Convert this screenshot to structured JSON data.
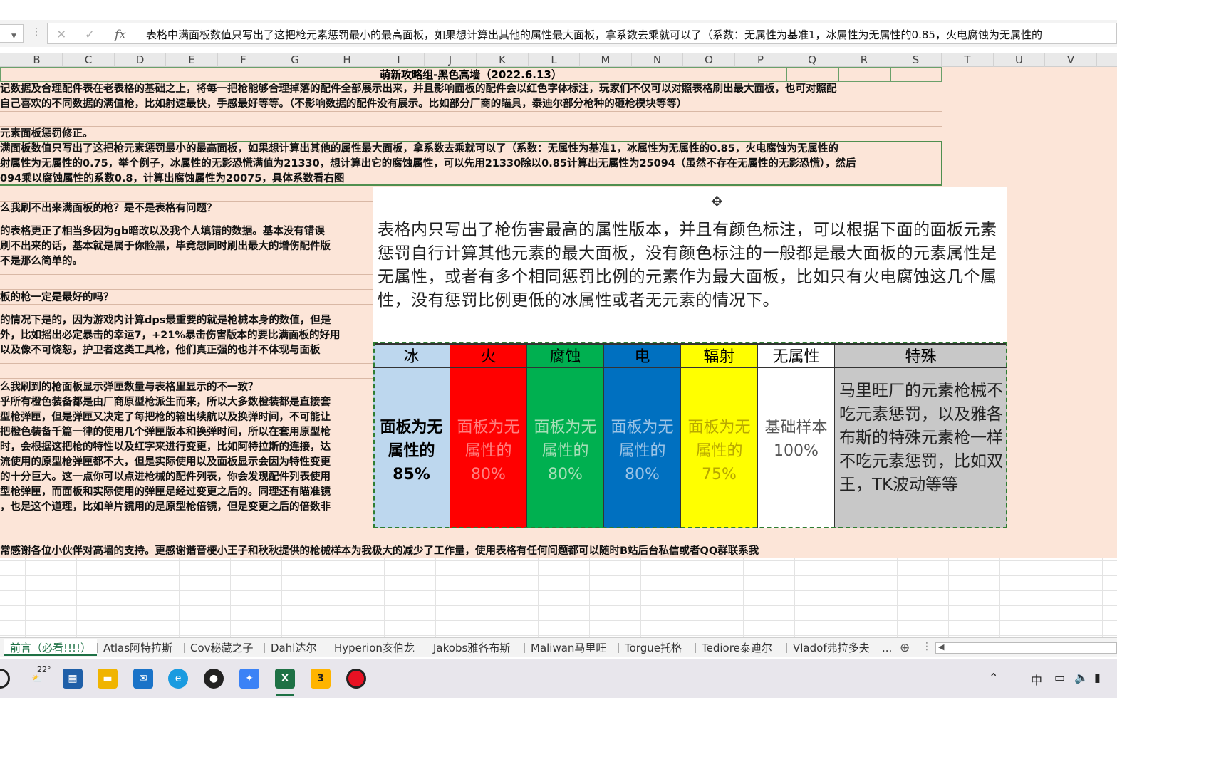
{
  "formula_bar": {
    "name_box": "",
    "cancel_icon": "✕",
    "enter_icon": "✓",
    "fx_label": "fx",
    "content": "表格中满面板数值只写出了这把枪元素惩罚最小的最高面板，如果想计算出其他的属性最大面板，拿系数去乘就可以了（系数：无属性为基准1，冰属性为无属性的0.85，火电腐蚀为无属性的"
  },
  "columns": [
    "B",
    "C",
    "D",
    "E",
    "F",
    "G",
    "H",
    "I",
    "J",
    "K",
    "L",
    "M",
    "N",
    "O",
    "P",
    "Q",
    "R",
    "S",
    "T",
    "U",
    "V"
  ],
  "sheet": {
    "title": "萌新攻略组-黑色高墙（2022.6.13）",
    "intro_line1": "记数据及合理配件表在老表格的基础之上，将每一把枪能够合理掉落的配件全部展示出来，并且影响面板的配件会以红色字体标注，玩家们不仅可以对照表格刷出最大面板，也可对照配",
    "intro_line2": "自己喜欢的不同数据的满值枪，比如射速最快，手感最好等等。（不影响数据的配件没有展示。比如部分厂商的瞄具，泰迪尔部分枪种的砸枪模块等等）",
    "section_heading": "元素面板惩罚修正。",
    "penalty_line1": "满面板数值只写出了这把枪元素惩罚最小的最高面板，如果想计算出其他的属性最大面板，拿系数去乘就可以了（系数：无属性为基准1，冰属性为无属性的0.85，火电腐蚀为无属性的",
    "penalty_line2": "射属性为无属性的0.75，举个例子，冰属性的无影恐慌满值为21330，想计算出它的腐蚀属性，可以先用21330除以0.85计算出无属性为25094（虽然不存在无属性的无影恐慌），然后",
    "penalty_line3": "094乘以腐蚀属性的系数0.8，计算出腐蚀属性为20075，具体系数看右图",
    "q1": "么我刷不出来满面板的枪？是不是表格有问题？",
    "a1_line1": "的表格更正了相当多因为gb暗改以及我个人填错的数据。基本没有错误",
    "a1_line2": "刷不出来的话，基本就是属于你脸黑，毕竟想同时刷出最大的增伤配件版",
    "a1_line3": "不是那么简单的。",
    "q2": "板的枪一定是最好的吗？",
    "a2_line1": "的情况下是的，因为游戏内计算dps最重要的就是枪械本身的数值，但是",
    "a2_line2": "外，比如摇出必定暴击的幸运7，+21%暴击伤害版本的要比满面板的好用",
    "a2_line3": "以及像不可饶恕，护卫者这类工具枪，他们真正强的也并不体现与面板",
    "q3": "么我刷到的枪面板显示弹匣数量与表格里显示的不一致？",
    "a3_line1": "乎所有橙色装备都是由厂商原型枪派生而来，所以大多数橙装都是直接套",
    "a3_line2": "型枪弹匣，但是弹匣又决定了每把枪的输出续航以及换弹时间，不可能让",
    "a3_line3": "把橙色装备千篇一律的使用几个弹匣版本和换弹时间，所以在套用原型枪",
    "a3_line4": "时，会根据这把枪的特性以及红字来进行变更，比如阿特拉斯的连接，达",
    "a3_line5": "流使用的原型枪弹匣都不大，但是实际使用以及面板显示会因为特性变更",
    "a3_line6": "的十分巨大。这一点你可以点进枪械的配件列表，你会发现配件列表使用",
    "a3_line7": "型枪弹匣，而面板和实际使用的弹匣是经过变更之后的。同理还有瞄准镜",
    "a3_line8": "，也是这个道理，比如单片镜用的是原型枪倍镜，但是变更之后的倍数非",
    "thanks": "常感谢各位小伙伴对高墙的支持。更感谢谐音梗小王子和秋秋提供的枪械样本为我极大的减少了工作量，使用表格有任何问题都可以随时B站后台私信或者QQ群联系我"
  },
  "overlay": {
    "paragraph": "表格内只写出了枪伤害最高的属性版本，并且有颜色标注，可以根据下面的面板元素惩罚自行计算其他元素的最大面板，没有颜色标注的一般都是最大面板的元素属性是无属性，或者有多个相同惩罚比例的元素作为最大面板，比如只有火电腐蚀这几个属性，没有惩罚比例更低的冰属性或者无元素的情况下。",
    "elements": [
      {
        "name": "冰",
        "text1": "面板为无",
        "text2": "属性的",
        "pct": "85%",
        "bg": "#bdd7ee",
        "fg": "#000000"
      },
      {
        "name": "火",
        "text1": "面板为无",
        "text2": "属性的",
        "pct": "80%",
        "bg": "#ff0000",
        "fg": "#ff8080"
      },
      {
        "name": "腐蚀",
        "text1": "面板为无",
        "text2": "属性的",
        "pct": "80%",
        "bg": "#00b050",
        "fg": "#a8dfb8"
      },
      {
        "name": "电",
        "text1": "面板为无",
        "text2": "属性的",
        "pct": "80%",
        "bg": "#0070c0",
        "fg": "#9cc4e6"
      },
      {
        "name": "辐射",
        "text1": "面板为无",
        "text2": "属性的",
        "pct": "75%",
        "bg": "#ffff00",
        "fg": "#b8a800"
      },
      {
        "name": "无属性",
        "text1": "基础样本",
        "text2": "100%",
        "pct": "",
        "bg": "#ffffff",
        "fg": "#555555"
      }
    ],
    "special": {
      "name": "特殊",
      "text": "马里旺厂的元素枪械不吃元素惩罚，以及雅各布斯的特殊元素枪一样不吃元素惩罚，比如双王，TK波动等等",
      "bg": "#c8c8c8"
    }
  },
  "tabs": [
    "前言（必看!!!!）",
    "Atlas阿特拉斯",
    "Cov秘藏之子",
    "Dahl达尔",
    "Hyperion亥伯龙",
    "Jakobs雅各布斯",
    "Maliwan马里旺",
    "Torgue托格",
    "Tediore泰迪尔",
    "Vladof弗拉多夫",
    "..."
  ],
  "taskbar": {
    "weather": "22°",
    "ime": "中"
  }
}
